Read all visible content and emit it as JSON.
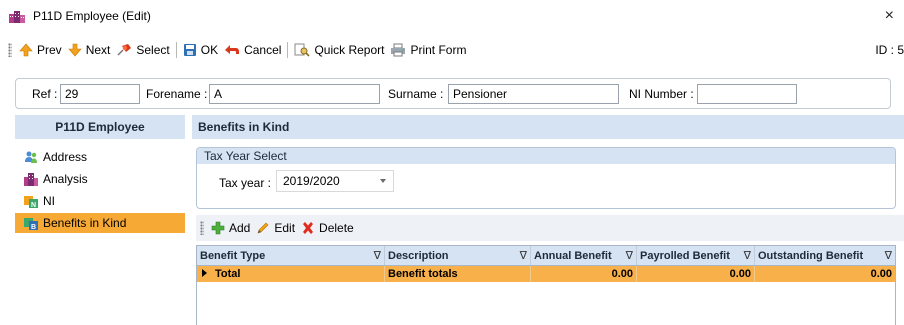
{
  "window": {
    "title": "P11D Employee (Edit)",
    "close_glyph": "×"
  },
  "toolbar": {
    "prev": "Prev",
    "next": "Next",
    "select": "Select",
    "ok": "OK",
    "cancel": "Cancel",
    "quick_report": "Quick Report",
    "print_form": "Print Form",
    "id_text": "ID : 5"
  },
  "header": {
    "ref_label": "Ref :",
    "ref_value": "29",
    "forename_label": "Forename :",
    "forename_value": "A",
    "surname_label": "Surname :",
    "surname_value": "Pensioner",
    "ni_label": "NI Number :",
    "ni_value": ""
  },
  "nav": {
    "title": "P11D Employee",
    "items": [
      {
        "label": "Address",
        "icon": "people-icon"
      },
      {
        "label": "Analysis",
        "icon": "buildings-icon"
      },
      {
        "label": "NI",
        "icon": "ni-icon"
      },
      {
        "label": "Benefits in Kind",
        "icon": "benefits-icon",
        "active": true
      }
    ]
  },
  "content": {
    "title": "Benefits in Kind",
    "tax_year_group": "Tax Year Select",
    "tax_year_label": "Tax year :",
    "tax_year_value": "2019/2020",
    "toolbar": {
      "add": "Add",
      "edit": "Edit",
      "delete": "Delete"
    },
    "grid": {
      "columns": [
        "Benefit Type",
        "Description",
        "Annual Benefit",
        "Payrolled Benefit",
        "Outstanding Benefit"
      ],
      "rows": [
        {
          "benefit_type": "Total",
          "description": "Benefit totals",
          "annual": "0.00",
          "payrolled": "0.00",
          "outstanding": "0.00"
        }
      ]
    }
  },
  "colors": {
    "active_nav": "#f7a935",
    "header_blue": "#d6e3f3",
    "total_row": "#f8b04b"
  }
}
